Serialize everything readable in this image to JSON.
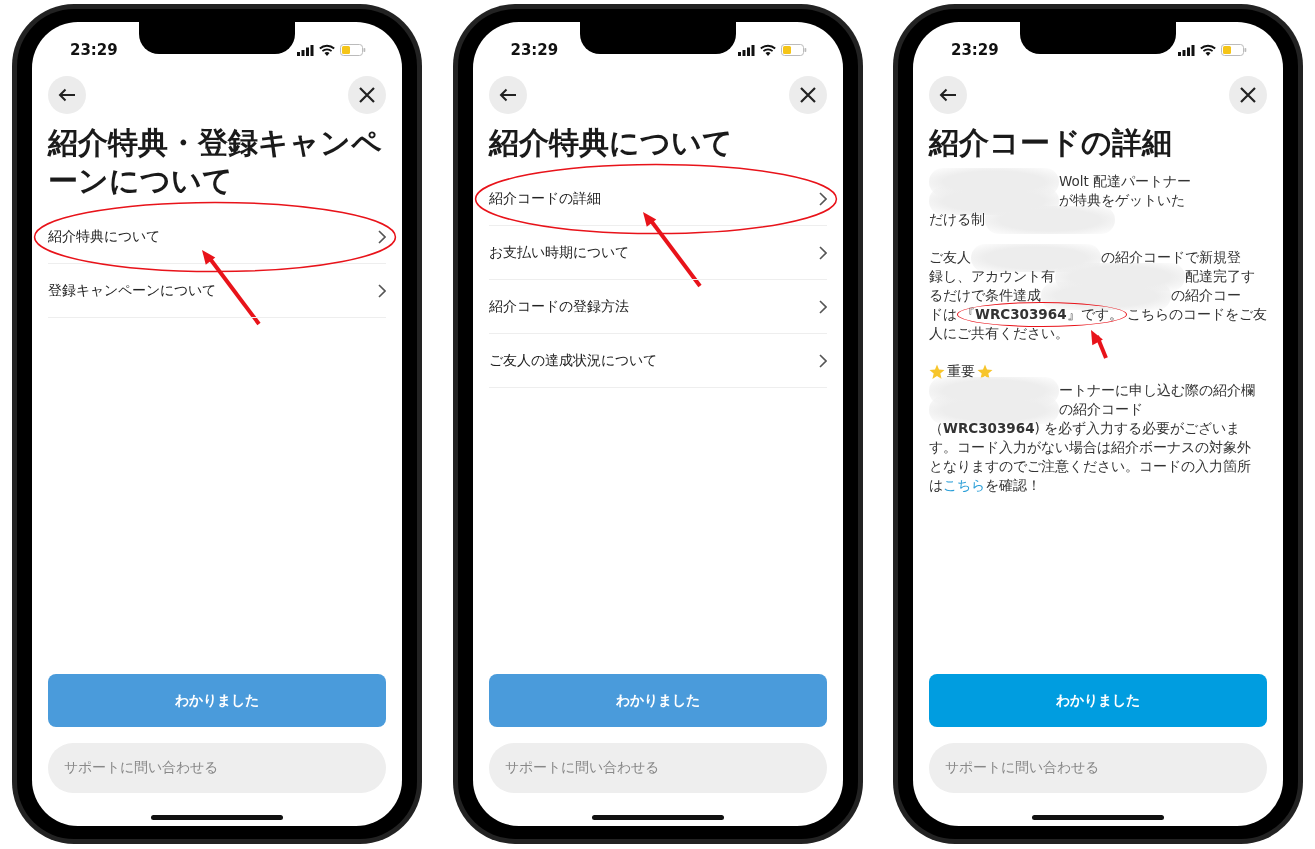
{
  "phones": [
    {
      "status_bar": {
        "time": "23:29"
      },
      "title": "紹介特典・登録キャンペーンについて",
      "menu_items": [
        {
          "label": "紹介特典について"
        },
        {
          "label": "登録キャンペーンについて"
        }
      ],
      "primary_button": {
        "label": "わかりました",
        "color": "#4a9bdb"
      },
      "secondary_button": {
        "label": "サポートに問い合わせる"
      }
    },
    {
      "status_bar": {
        "time": "23:29"
      },
      "title": "紹介特典について",
      "menu_items": [
        {
          "label": "紹介コードの詳細"
        },
        {
          "label": "お支払い時期について"
        },
        {
          "label": "紹介コードの登録方法"
        },
        {
          "label": "ご友人の達成状況について"
        }
      ],
      "primary_button": {
        "label": "わかりました",
        "color": "#4a9bdb"
      },
      "secondary_button": {
        "label": "サポートに問い合わせる"
      }
    },
    {
      "status_bar": {
        "time": "23:29"
      },
      "title": "紹介コードの詳細",
      "body": [
        {
          "lines": [
            [
              {
                "kind": "redacted"
              },
              {
                "kind": "text",
                "text": "Wolt 配達パートナー"
              }
            ],
            [
              {
                "kind": "redacted"
              },
              {
                "kind": "text",
                "text": "が特典をゲットいた"
              }
            ],
            [
              {
                "kind": "text",
                "text": "だける制"
              },
              {
                "kind": "redacted"
              }
            ]
          ]
        },
        {
          "lines": [
            [
              {
                "kind": "text",
                "text": "ご友人"
              },
              {
                "kind": "redacted"
              },
              {
                "kind": "text",
                "text": "の紹介コードで新規登"
              }
            ],
            [
              {
                "kind": "text",
                "text": "録し、アカウント有"
              },
              {
                "kind": "redacted"
              },
              {
                "kind": "text",
                "text": "配達完了す"
              }
            ],
            [
              {
                "kind": "text",
                "text": "るだけで条件達成"
              },
              {
                "kind": "redacted"
              },
              {
                "kind": "text",
                "text": "の紹介コー"
              }
            ],
            [
              {
                "kind": "text",
                "text": "ドは"
              },
              {
                "kind": "circled",
                "text": "『**WRC303964**』です。"
              },
              {
                "kind": "text",
                "text": "こちらのコードをご友"
              }
            ],
            [
              {
                "kind": "text",
                "text": "人にご共有ください。"
              }
            ]
          ]
        },
        {
          "heading": "重要",
          "lines": [
            [
              {
                "kind": "redacted"
              },
              {
                "kind": "text",
                "text": "ートナーに申し込む際の紹介欄"
              }
            ],
            [
              {
                "kind": "redacted"
              },
              {
                "kind": "text",
                "text": "の紹介コード"
              }
            ],
            [
              {
                "kind": "text",
                "text": "（**WRC303964**) を必ず入力する必要がございま"
              }
            ],
            [
              {
                "kind": "text",
                "text": "す。コード入力がない場合は紹介ボーナスの対象外"
              }
            ],
            [
              {
                "kind": "text",
                "text": "となりますのでご注意ください。コードの入力箇所"
              }
            ],
            [
              {
                "kind": "text",
                "text": "は"
              },
              {
                "kind": "link",
                "text": "こちら"
              },
              {
                "kind": "text",
                "text": "を確認！"
              }
            ]
          ]
        }
      ],
      "primary_button": {
        "label": "わかりました",
        "color": "#009de0"
      },
      "secondary_button": {
        "label": "サポートに問い合わせる"
      }
    }
  ]
}
